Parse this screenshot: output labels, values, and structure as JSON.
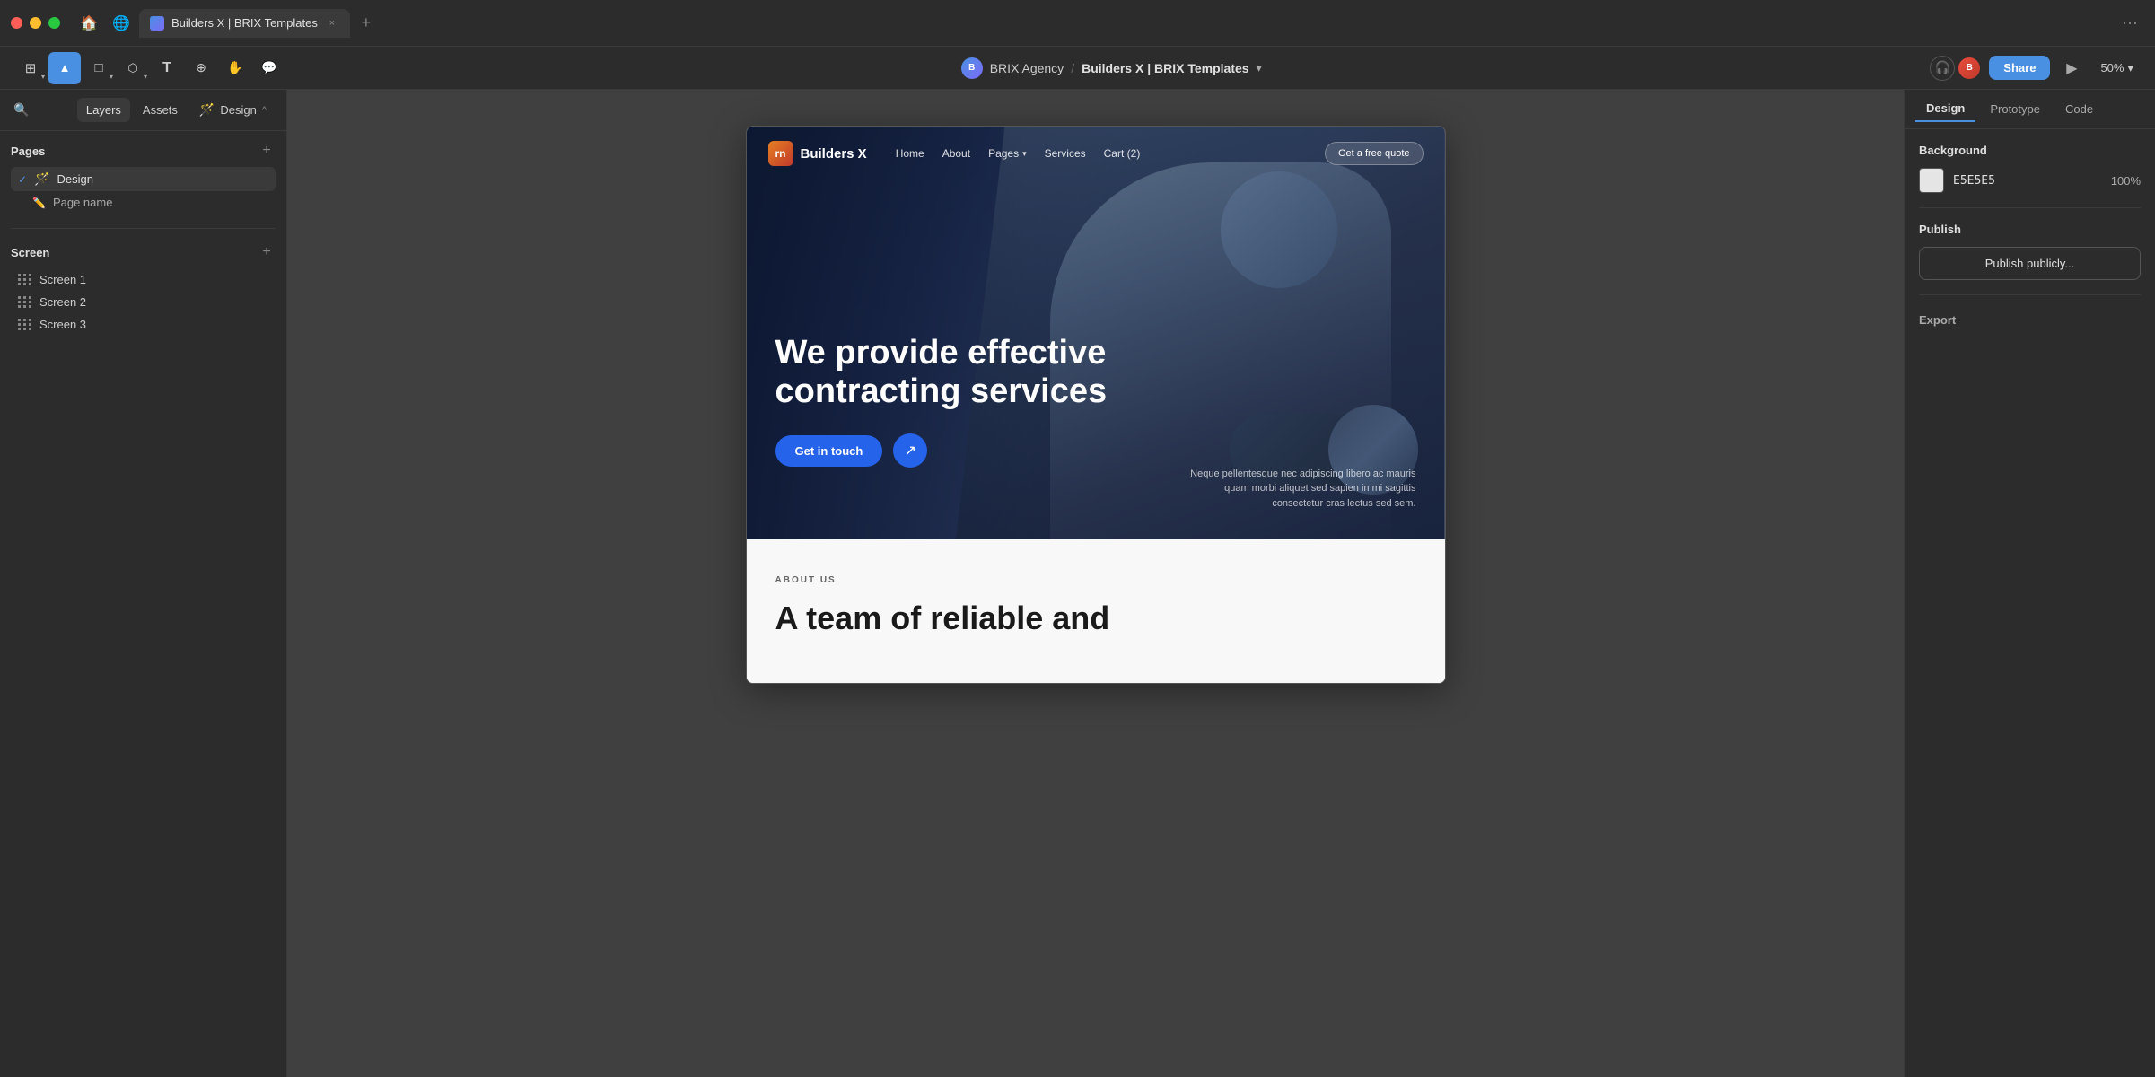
{
  "browser": {
    "window_controls": [
      "red",
      "yellow",
      "green"
    ],
    "tab_label": "Builders X | BRIX Templates",
    "tab_close": "×",
    "tab_add": "+",
    "more_icon": "···"
  },
  "toolbar": {
    "tools": [
      {
        "name": "select-group",
        "icon": "⊞",
        "has_caret": true
      },
      {
        "name": "pointer",
        "icon": "▲",
        "active": true
      },
      {
        "name": "frame-tool",
        "icon": "□",
        "has_caret": true
      },
      {
        "name": "shape-tool",
        "icon": "⬡",
        "has_caret": true
      },
      {
        "name": "text-tool",
        "icon": "T"
      },
      {
        "name": "component-tool",
        "icon": "⊕"
      },
      {
        "name": "hand-tool",
        "icon": "✋"
      },
      {
        "name": "comment-tool",
        "icon": "💬"
      }
    ],
    "project": {
      "workspace": "BRIX Agency",
      "separator": "/",
      "file": "Builders X | BRIX Templates",
      "chevron": "▾"
    },
    "right": {
      "headphone_icon": "🎧",
      "share_label": "Share",
      "play_icon": "▶",
      "zoom": "50%",
      "zoom_caret": "▾"
    }
  },
  "left_panel": {
    "search_icon": "🔍",
    "tabs": [
      {
        "label": "Layers",
        "active": true
      },
      {
        "label": "Assets"
      },
      {
        "label": "Design",
        "emoji": "🪄",
        "caret": "^"
      }
    ],
    "pages_section": {
      "title": "Pages",
      "add_icon": "+",
      "items": [
        {
          "label": "Design",
          "icon": "🪄",
          "checked": true,
          "indent": 0
        },
        {
          "label": "Page name",
          "icon": "✏️",
          "checked": false,
          "indent": 1
        }
      ]
    },
    "screen_section": {
      "title": "Screen",
      "add_icon": "+",
      "items": [
        {
          "label": "Screen 1"
        },
        {
          "label": "Screen 2"
        },
        {
          "label": "Screen 3"
        }
      ]
    }
  },
  "canvas": {
    "website": {
      "nav": {
        "logo_text": "Builders X",
        "logo_abbr": "rn",
        "links": [
          "Home",
          "About",
          "Pages",
          "Services",
          "Cart (2)"
        ],
        "cta": "Get a free quote"
      },
      "hero": {
        "title": "We provide effective contracting services",
        "cta_primary": "Get in touch",
        "cta_arrow": "↗",
        "description": "Neque pellentesque nec adipiscing libero ac mauris quam morbi aliquet sed sapien in mi sagittis consectetur cras lectus sed sem."
      },
      "about": {
        "label": "ABOUT US",
        "title": "A team of reliable and"
      }
    }
  },
  "right_panel": {
    "tabs": [
      "Design",
      "Prototype",
      "Code"
    ],
    "active_tab": "Design",
    "background_section": {
      "title": "Background",
      "color_hex": "E5E5E5",
      "opacity": "100%"
    },
    "publish_section": {
      "title": "Publish",
      "button_label": "Publish publicly..."
    },
    "export_section": {
      "title": "Export"
    }
  }
}
